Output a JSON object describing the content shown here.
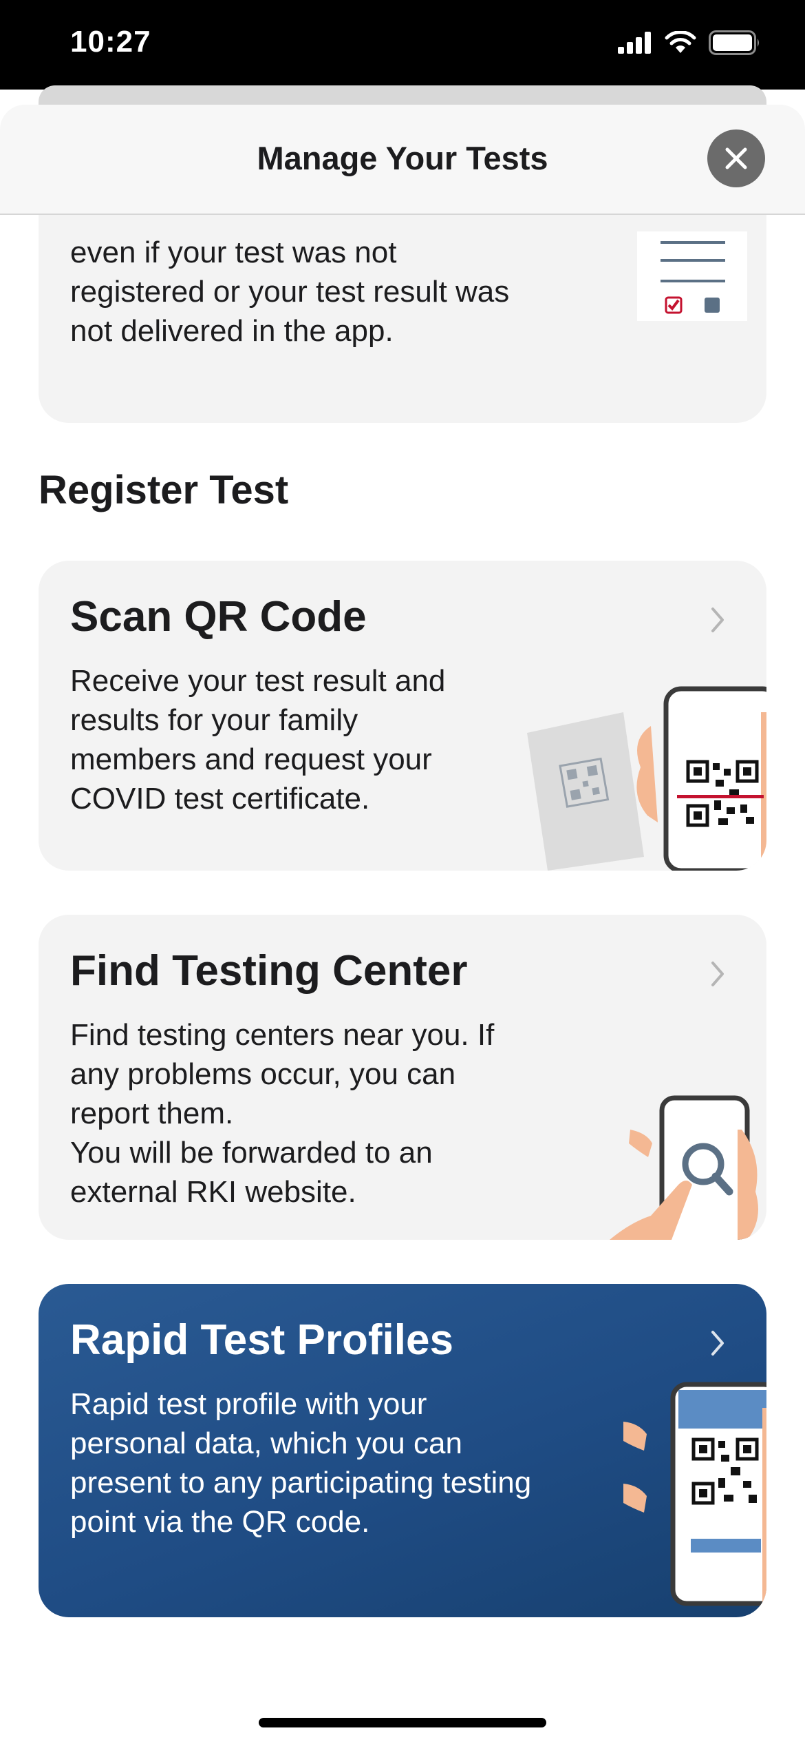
{
  "status_bar": {
    "time": "10:27"
  },
  "nav": {
    "title": "Manage Your Tests"
  },
  "top_card": {
    "text_lines": [
      "even if your test was not",
      "registered or your test result was",
      "not delivered in the app."
    ]
  },
  "section": {
    "heading": "Register Test"
  },
  "cards": [
    {
      "title": "Scan QR Code",
      "lines": [
        "Receive your test result and",
        "results for your family",
        "members and request your",
        "COVID test certificate."
      ]
    },
    {
      "title": "Find Testing Center",
      "lines": [
        "Find testing centers near you. If",
        "any problems occur, you can",
        "report them.",
        "You will be forwarded to an",
        "external RKI website."
      ]
    },
    {
      "title": "Rapid Test Profiles",
      "lines": [
        "Rapid test profile with your",
        "personal data, which you can",
        "present to any participating testing",
        "point via the QR code."
      ]
    }
  ],
  "colors": {
    "card_bg": "#f3f3f3",
    "accent_blue": "#1f4c84",
    "checkbox_red": "#c4122f",
    "close_button": "#6b6b6b"
  },
  "icons": {
    "close": "close-icon",
    "chevron": "chevron-right-icon",
    "signal": "cellular-signal-icon",
    "wifi": "wifi-icon",
    "battery": "battery-icon"
  }
}
